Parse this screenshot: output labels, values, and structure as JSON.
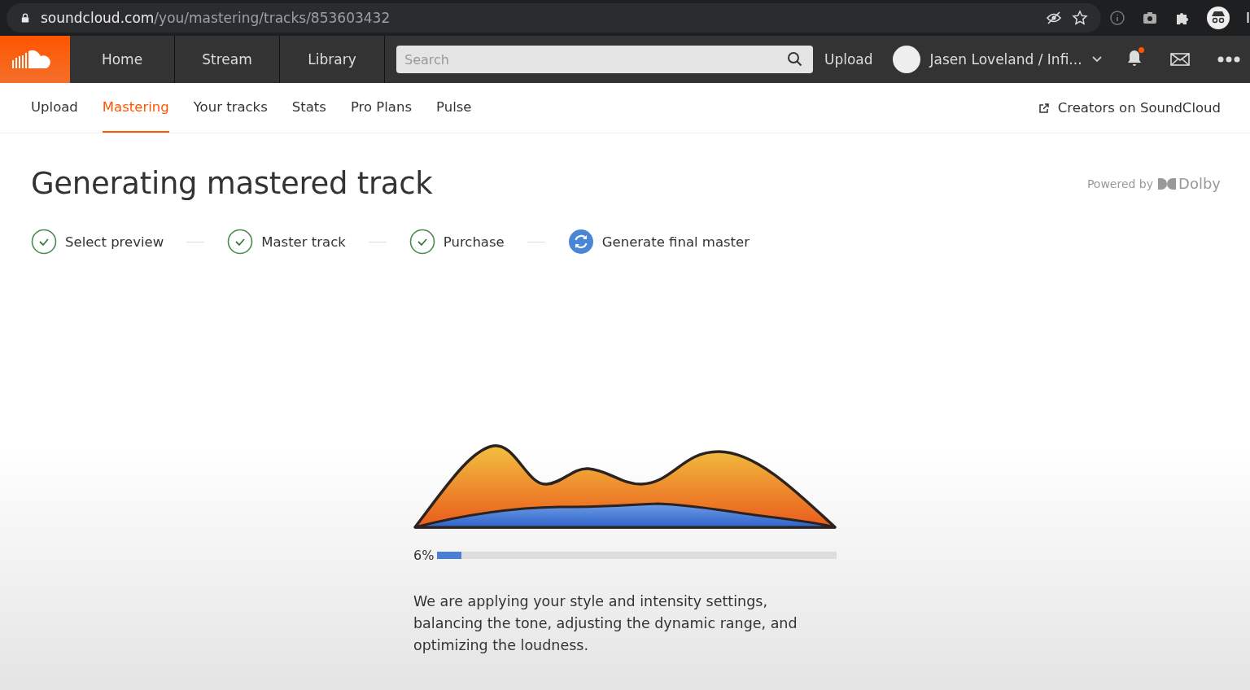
{
  "browser": {
    "url_host": "soundcloud.com",
    "url_path": "/you/mastering/tracks/853603432",
    "profile_text": "I"
  },
  "header": {
    "nav": [
      {
        "label": "Home",
        "selected": false
      },
      {
        "label": "Stream",
        "selected": false
      },
      {
        "label": "Library",
        "selected": false
      }
    ],
    "search": {
      "placeholder": "Search"
    },
    "upload": "Upload",
    "user": "Jasen Loveland / Infi...",
    "notification_dot": true
  },
  "subnav": {
    "tabs": [
      {
        "label": "Upload",
        "selected": false
      },
      {
        "label": "Mastering",
        "selected": true
      },
      {
        "label": "Your tracks",
        "selected": false
      },
      {
        "label": "Stats",
        "selected": false
      },
      {
        "label": "Pro Plans",
        "selected": false
      },
      {
        "label": "Pulse",
        "selected": false
      }
    ],
    "creators_link": "Creators on SoundCloud"
  },
  "page": {
    "title": "Generating mastered track",
    "powered_by": "Powered by",
    "powered_brand": "Dolby",
    "steps": [
      {
        "label": "Select preview",
        "kind": "done"
      },
      {
        "label": "Master track",
        "kind": "done"
      },
      {
        "label": "Purchase",
        "kind": "done"
      },
      {
        "label": "Generate final master",
        "kind": "active"
      }
    ],
    "progress": {
      "reading": "6%",
      "level": 0.06
    },
    "message": "We are applying your style and intensity settings, balancing the tone, adjusting the dynamic range, and optimizing the loudness."
  }
}
